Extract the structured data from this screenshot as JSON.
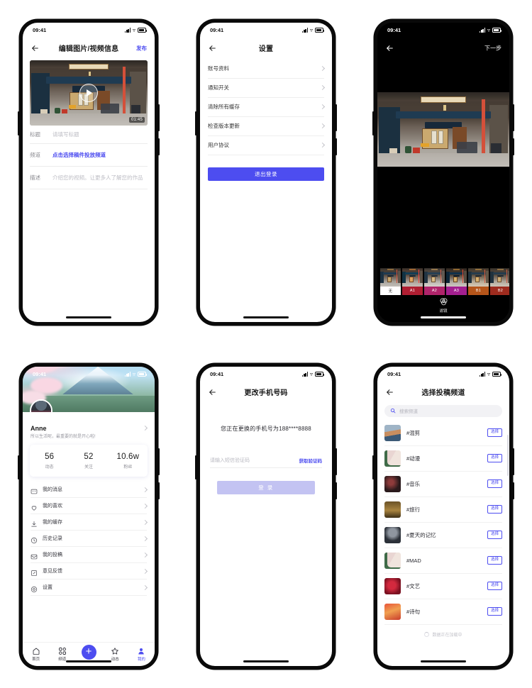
{
  "accent": "#4d4df0",
  "statusbar": {
    "time": "09:41",
    "signal_icon": "signal-bars-icon",
    "wifi_icon": "wifi-icon",
    "battery_icon": "battery-icon"
  },
  "screens": {
    "edit_media": {
      "nav": {
        "back_icon": "back-arrow-icon",
        "title": "编辑图片/视频信息",
        "action": "发布"
      },
      "media": {
        "play_icon": "play-icon",
        "duration": "01:45"
      },
      "fields": [
        {
          "label": "标题",
          "value": "请填写标题",
          "is_link": false
        },
        {
          "label": "频道",
          "value": "点击选择稿件投放频道",
          "is_link": true
        },
        {
          "label": "描述",
          "value": "介绍您的视频。让更多人了解您的作品",
          "is_link": false
        }
      ]
    },
    "settings": {
      "nav": {
        "back_icon": "back-arrow-icon",
        "title": "设置"
      },
      "items": [
        {
          "label": "账号资料"
        },
        {
          "label": "通知开关"
        },
        {
          "label": "清除所有缓存"
        },
        {
          "label": "检查版本更新"
        },
        {
          "label": "用户协议"
        }
      ],
      "logout_label": "退出登录"
    },
    "filter": {
      "nav": {
        "back_icon": "back-arrow-icon",
        "action": "下一步"
      },
      "filters": [
        {
          "name": "无",
          "color": "#ffffff",
          "text_color": "#222222"
        },
        {
          "name": "A1",
          "color": "#b01e32",
          "text_color": "#ffffff"
        },
        {
          "name": "A2",
          "color": "#b0246b",
          "text_color": "#ffffff"
        },
        {
          "name": "A3",
          "color": "#a31f8f",
          "text_color": "#ffffff"
        },
        {
          "name": "B1",
          "color": "#b5551a",
          "text_color": "#ffffff"
        },
        {
          "name": "B2",
          "color": "#9e2b1e",
          "text_color": "#ffffff"
        }
      ],
      "tool": {
        "icon": "filter-rings-icon",
        "label": "滤镜"
      }
    },
    "profile": {
      "name": "Anne",
      "bio": "所以生活呢，最重要的就是开心啦!",
      "avatar_icon": "user-avatar",
      "chevron_icon": "chevron-right-icon",
      "stats": [
        {
          "value": "56",
          "label": "动态"
        },
        {
          "value": "52",
          "label": "关注"
        },
        {
          "value": "10.6w",
          "label": "粉丝"
        }
      ],
      "menu": [
        {
          "label": "我的消息",
          "icon": "message-icon"
        },
        {
          "label": "我的喜欢",
          "icon": "heart-icon"
        },
        {
          "label": "我的缓存",
          "icon": "download-icon"
        },
        {
          "label": "历史记录",
          "icon": "clock-icon"
        },
        {
          "label": "我的投稿",
          "icon": "inbox-icon"
        },
        {
          "label": "意见反馈",
          "icon": "edit-note-icon"
        },
        {
          "label": "设置",
          "icon": "gear-icon"
        }
      ],
      "tabs": [
        {
          "label": "首页",
          "icon": "home-icon",
          "active": false
        },
        {
          "label": "频道",
          "icon": "grid-icon",
          "active": false
        },
        {
          "label": "",
          "icon": "plus-icon",
          "active": false
        },
        {
          "label": "动态",
          "icon": "star-icon",
          "active": false
        },
        {
          "label": "我的",
          "icon": "person-icon",
          "active": true
        }
      ]
    },
    "change_phone": {
      "nav": {
        "back_icon": "back-arrow-icon",
        "title": "更改手机号码"
      },
      "hint": "您正在更换的手机号为188****8888",
      "code_placeholder": "请输入短信验证码",
      "get_code_label": "获取验证码",
      "submit_label": "登 录"
    },
    "channel_select": {
      "nav": {
        "back_icon": "back-arrow-icon",
        "title": "选择投稿频道"
      },
      "search": {
        "icon": "search-icon",
        "placeholder": "搜索频道"
      },
      "pick_label": "选择",
      "channels": [
        {
          "name": "#混剪",
          "thumb": "thumb-portrait"
        },
        {
          "name": "#动漫",
          "thumb": "thumb-plant"
        },
        {
          "name": "#音乐",
          "thumb": "thumb-dark-flowers"
        },
        {
          "name": "#旅行",
          "thumb": "thumb-gold"
        },
        {
          "name": "#夏天的记忆",
          "thumb": "thumb-umbrella"
        },
        {
          "name": "#MAD",
          "thumb": "thumb-plant"
        },
        {
          "name": "#文艺",
          "thumb": "thumb-red-flowers"
        },
        {
          "name": "#诗句",
          "thumb": "thumb-orange"
        }
      ],
      "loading_text": "数据正在加载中",
      "loading_icon": "spinner-icon"
    }
  }
}
